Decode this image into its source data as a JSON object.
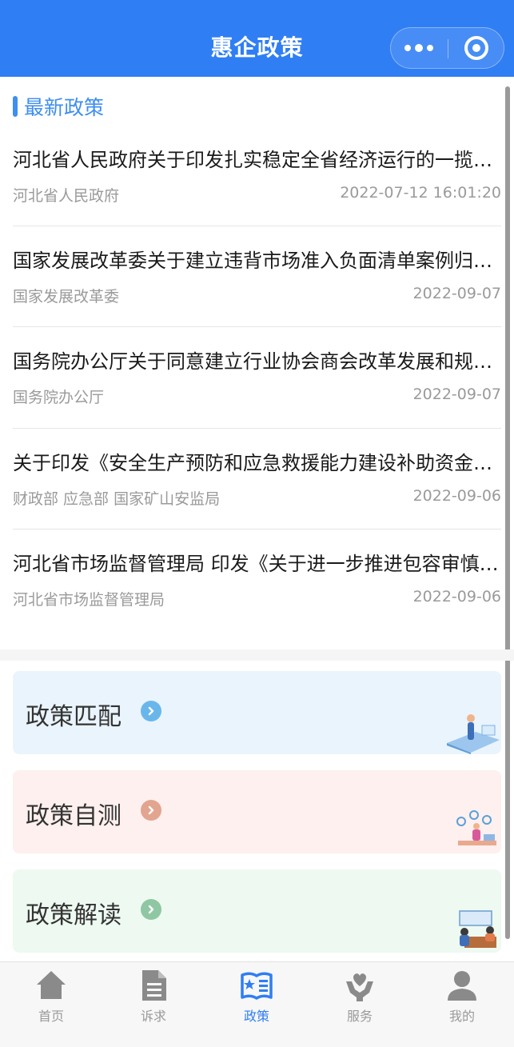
{
  "header": {
    "title": "惠企政策"
  },
  "section": {
    "title": "最新政策"
  },
  "news": [
    {
      "title": "河北省人民政府关于印发扎实稳定全省经济运行的一揽子措施及配套政策的通知",
      "source": "河北省人民政府",
      "date": "2022-07-12 16:01:20"
    },
    {
      "title": "国家发展改革委关于建立违背市场准入负面清单案例归集和通报制度的通知",
      "source": "国家发展改革委",
      "date": "2022-09-07"
    },
    {
      "title": "国务院办公厅关于同意建立行业协会商会改革发展和规范管理部际联席会议制度的函",
      "source": "国务院办公厅",
      "date": "2022-09-07"
    },
    {
      "title": "关于印发《安全生产预防和应急救援能力建设补助资金管理办法》的通知",
      "source": "财政部 应急部 国家矿山安监局",
      "date": "2022-09-06"
    },
    {
      "title": "河北省市场监督管理局 印发《关于进一步推进包容审慎监管的若干措施》的通知",
      "source": "河北省市场监督管理局",
      "date": "2022-09-06"
    }
  ],
  "cards": [
    {
      "label": "政策匹配",
      "bg": "#eaf4fd",
      "arrow": "#69b7ea"
    },
    {
      "label": "政策自测",
      "bg": "#fdf0ee",
      "arrow": "#e2a58f"
    },
    {
      "label": "政策解读",
      "bg": "#edf9f1",
      "arrow": "#8fc7a3"
    }
  ],
  "tabs": [
    {
      "label": "首页",
      "icon": "home-icon",
      "active": false
    },
    {
      "label": "诉求",
      "icon": "document-icon",
      "active": false
    },
    {
      "label": "政策",
      "icon": "policy-book-icon",
      "active": true
    },
    {
      "label": "服务",
      "icon": "service-heart-hand-icon",
      "active": false
    },
    {
      "label": "我的",
      "icon": "user-icon",
      "active": false
    }
  ],
  "colors": {
    "primary": "#2f7ef4",
    "accent": "#3f8ef0",
    "muted": "#9a9a9a",
    "inactive_icon": "#8a8a8a"
  }
}
